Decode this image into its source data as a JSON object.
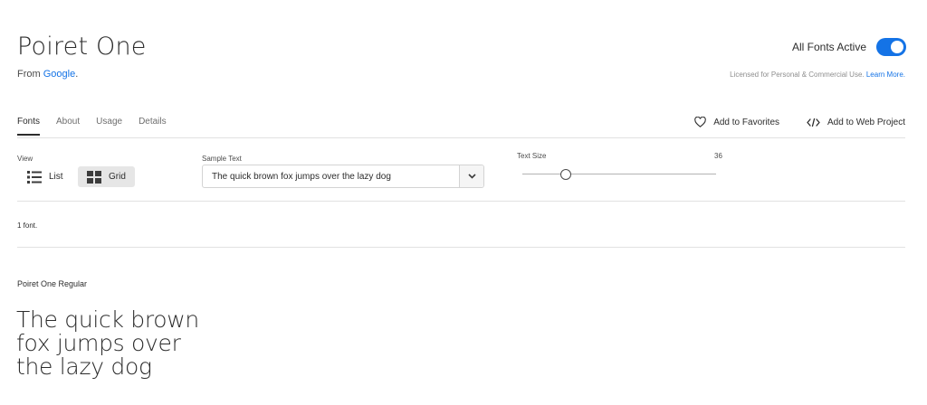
{
  "header": {
    "title": "Poiret One",
    "from_prefix": "From ",
    "from_link": "Google",
    "from_suffix": ".",
    "active_label": "All Fonts Active",
    "license_text": "Licensed for Personal & Commercial Use.",
    "license_link": "Learn More."
  },
  "tabs": [
    {
      "label": "Fonts",
      "active": true
    },
    {
      "label": "About",
      "active": false
    },
    {
      "label": "Usage",
      "active": false
    },
    {
      "label": "Details",
      "active": false
    }
  ],
  "actions": {
    "favorites": "Add to Favorites",
    "web_project": "Add to Web Project"
  },
  "controls": {
    "view_label": "View",
    "list_label": "List",
    "grid_label": "Grid",
    "selected_view": "Grid",
    "sample_label": "Sample Text",
    "sample_value": "The quick brown fox jumps over the lazy dog",
    "size_label": "Text Size",
    "size_value": "36",
    "size_slider_fraction": 0.22
  },
  "results": {
    "count": "1 font.",
    "fonts": [
      {
        "name": "Poiret One Regular",
        "specimen": "The quick brown fox jumps over the lazy dog"
      }
    ]
  },
  "colors": {
    "accent": "#1473e6",
    "text": "#2c2c2c",
    "divider": "#e1e1e1"
  },
  "icons": {
    "toggle": "toggle-on-icon",
    "favorites": "heart-icon",
    "web_project": "code-icon",
    "list": "list-view-icon",
    "grid": "grid-view-icon",
    "dropdown": "chevron-down-icon"
  }
}
